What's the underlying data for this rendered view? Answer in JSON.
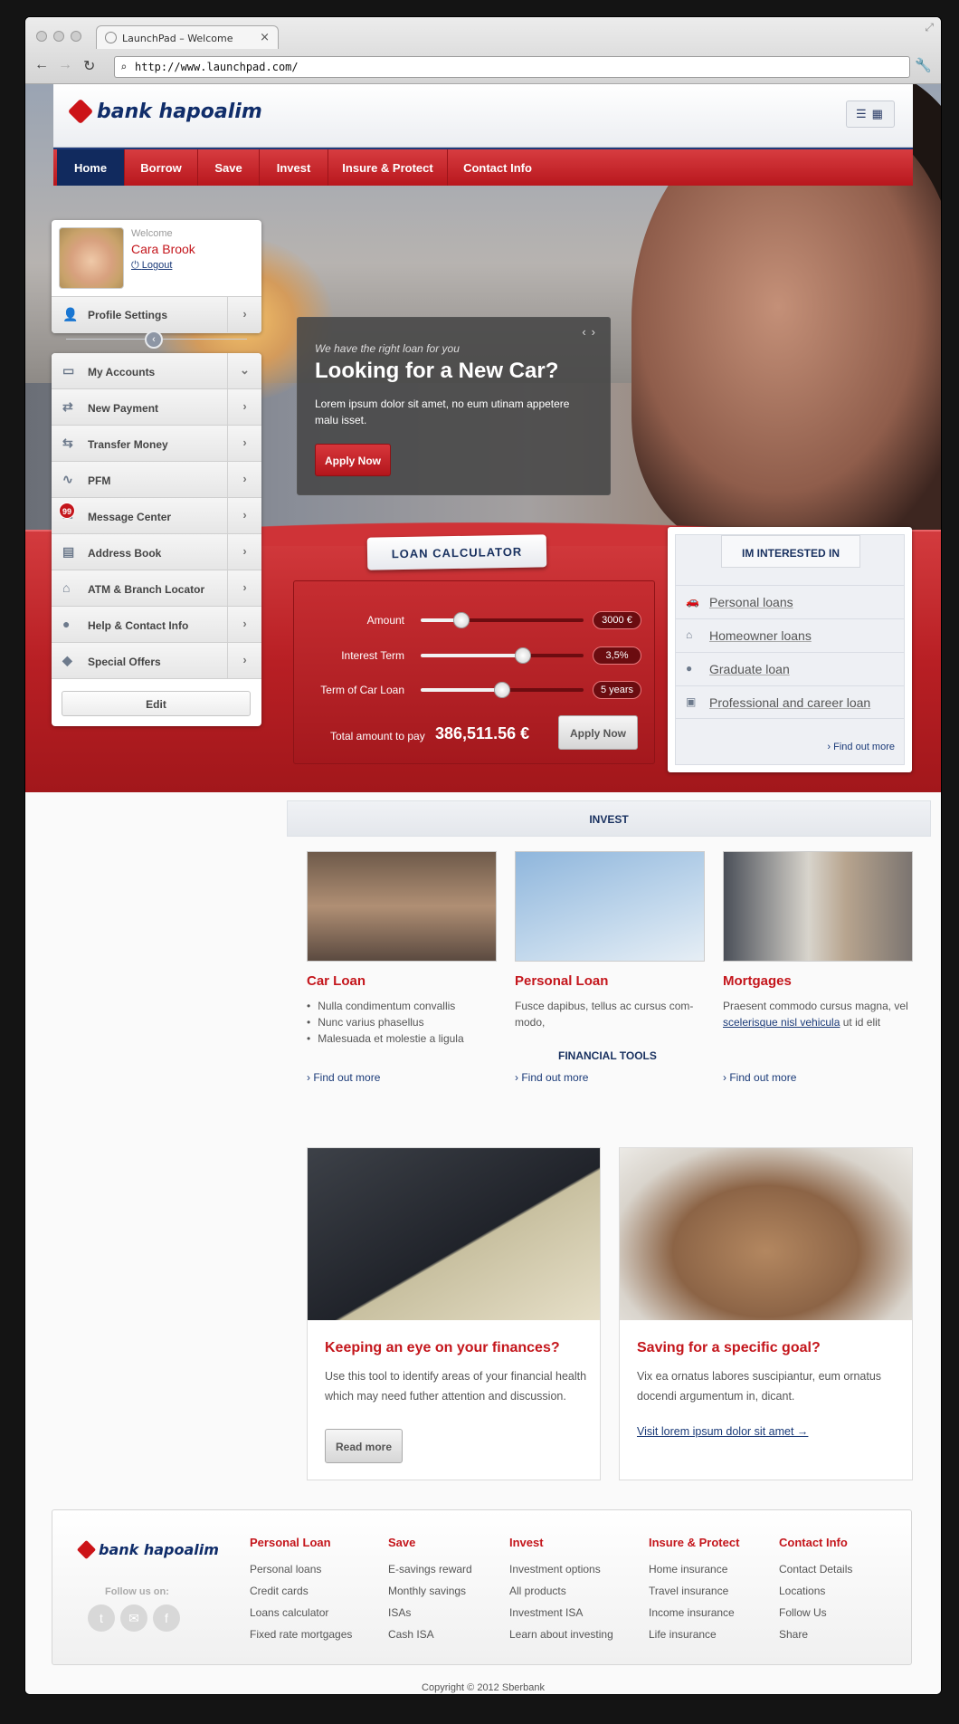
{
  "browser": {
    "tab_title": "LaunchPad – Welcome",
    "url": "http://www.launchpad.com/"
  },
  "brand": {
    "name": "bank hapoalim",
    "accent": "#c4161c",
    "navy": "#112a5e"
  },
  "nav": {
    "items": [
      {
        "label": "Home",
        "active": true
      },
      {
        "label": "Borrow"
      },
      {
        "label": "Save"
      },
      {
        "label": "Invest"
      },
      {
        "label": "Insure & Protect"
      },
      {
        "label": "Contact Info"
      }
    ]
  },
  "profile": {
    "welcome": "Welcome",
    "name": "Cara Brook",
    "logout": "Logout",
    "settings": "Profile Settings"
  },
  "sidebar": {
    "items": [
      {
        "label": "My Accounts",
        "icon": "briefcase-icon",
        "chevron": "down"
      },
      {
        "label": "New Payment",
        "icon": "payment-icon"
      },
      {
        "label": "Transfer Money",
        "icon": "transfer-icon"
      },
      {
        "label": "PFM",
        "icon": "chart-icon"
      },
      {
        "label": "Message Center",
        "icon": "message-icon",
        "badge": "99"
      },
      {
        "label": "Address Book",
        "icon": "book-icon"
      },
      {
        "label": "ATM & Branch Locator",
        "icon": "bank-icon"
      },
      {
        "label": "Help & Contact Info",
        "icon": "chat-icon"
      },
      {
        "label": "Special Offers",
        "icon": "tag-icon"
      }
    ],
    "edit": "Edit"
  },
  "slide": {
    "kicker": "We have the right loan for you",
    "title": "Looking for a New Car?",
    "text": "Lorem ipsum dolor sit amet, no eum utinam appetere malu isset.",
    "button": "Apply Now"
  },
  "calculator": {
    "title": "LOAN CALCULATOR",
    "rows": [
      {
        "label": "Amount",
        "value": "3000 €",
        "level": 0.25
      },
      {
        "label": "Interest Term",
        "value": "3,5%",
        "level": 0.63
      },
      {
        "label": "Term of Car Loan",
        "value": "5 years",
        "level": 0.5
      }
    ],
    "total_label": "Total amount to pay",
    "total_value": "386,511.56 €",
    "button": "Apply Now"
  },
  "interest": {
    "title": "IM INTERESTED IN",
    "items": [
      {
        "label": "Personal loans",
        "icon": "car-icon"
      },
      {
        "label": "Homeowner loans",
        "icon": "home-icon"
      },
      {
        "label": "Graduate loan",
        "icon": "award-icon"
      },
      {
        "label": "Professional and career loan",
        "icon": "case-icon"
      }
    ],
    "find_more": "Find out more"
  },
  "invest": {
    "title": "INVEST",
    "cards": [
      {
        "title": "Car Loan",
        "bullets": [
          "Nulla condimentum convallis",
          "Nunc varius phasellus",
          "Malesuada et molestie a ligula"
        ],
        "link": "Find out more"
      },
      {
        "title": "Personal Loan",
        "text": "Fusce dapibus, tellus ac cursus com-modo,",
        "link": "Find out more"
      },
      {
        "title": "Mortgages",
        "text_a": "Praesent commodo cursus magna, vel",
        "text_link": "scelerisque nisl vehicula",
        "text_b": "ut id elit",
        "link": "Find out more"
      }
    ]
  },
  "tools": {
    "title": "FINANCIAL TOOLS",
    "items": [
      {
        "title": "Keeping an eye on your finances?",
        "text": "Use this tool to identify areas of your financial health which may need futher attention and discussion.",
        "button": "Read more"
      },
      {
        "title": "Saving for a specific goal?",
        "text": "Vix ea ornatus labores suscipiantur, eum ornatus docendi argumentum in, dicant.",
        "link": "Visit lorem ipsum dolor sit amet →"
      }
    ]
  },
  "footer": {
    "follow": "Follow us on:",
    "columns": [
      {
        "title": "Personal Loan",
        "links": [
          "Personal loans",
          "Credit cards",
          "Loans calculator",
          "Fixed rate mortgages"
        ]
      },
      {
        "title": "Save",
        "links": [
          "E-savings reward",
          "Monthly savings",
          "ISAs",
          "Cash ISA"
        ]
      },
      {
        "title": "Invest",
        "links": [
          "Investment options",
          "All products",
          "Investment ISA",
          "Learn about investing"
        ]
      },
      {
        "title": "Insure & Protect",
        "links": [
          "Home insurance",
          "Travel insurance",
          "Income insurance",
          "Life insurance"
        ]
      },
      {
        "title": "Contact Info",
        "links": [
          "Contact Details",
          "Locations",
          "Follow Us",
          "Share"
        ]
      }
    ],
    "copyright": "Copyright © 2012 Sberbank"
  }
}
